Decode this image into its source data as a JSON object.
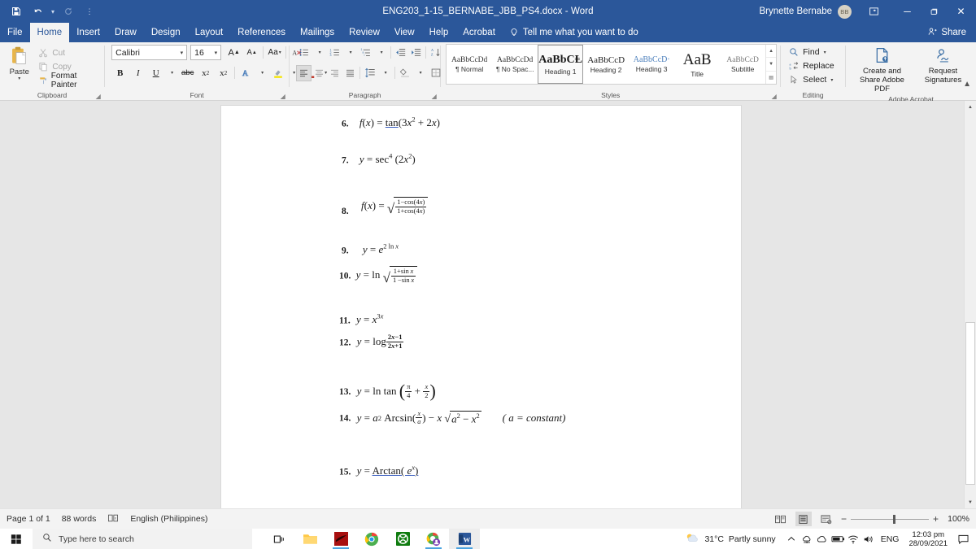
{
  "titlebar": {
    "document_title": "ENG203_1-15_BERNABE_JBB_PS4.docx  -  Word",
    "account_name": "Brynette Bernabe",
    "avatar_initials": "BB",
    "quick_access": [
      "save-icon",
      "undo-icon",
      "redo-icon",
      "customize-icon"
    ],
    "window_buttons": {
      "minimize": "─",
      "restore": "❐",
      "close": "✕"
    }
  },
  "tabs": [
    {
      "label": "File",
      "active": false
    },
    {
      "label": "Home",
      "active": true
    },
    {
      "label": "Insert",
      "active": false
    },
    {
      "label": "Draw",
      "active": false
    },
    {
      "label": "Design",
      "active": false
    },
    {
      "label": "Layout",
      "active": false
    },
    {
      "label": "References",
      "active": false
    },
    {
      "label": "Mailings",
      "active": false
    },
    {
      "label": "Review",
      "active": false
    },
    {
      "label": "View",
      "active": false
    },
    {
      "label": "Help",
      "active": false
    },
    {
      "label": "Acrobat",
      "active": false
    }
  ],
  "tell_me": "Tell me what you want to do",
  "share_label": "Share",
  "ribbon": {
    "clipboard": {
      "group_label": "Clipboard",
      "paste_label": "Paste",
      "items": [
        {
          "label": "Cut",
          "icon": "scissors-icon",
          "enabled": false
        },
        {
          "label": "Copy",
          "icon": "copy-icon",
          "enabled": false
        },
        {
          "label": "Format Painter",
          "icon": "format-painter-icon",
          "enabled": true
        }
      ]
    },
    "font": {
      "group_label": "Font",
      "font_family": "Calibri",
      "font_size": "16",
      "buttons_row1": [
        "grow-font-icon",
        "shrink-font-icon",
        "change-case-icon",
        "clear-formatting-icon"
      ],
      "buttons_row2": [
        "bold-icon",
        "italic-icon",
        "underline-icon",
        "strikethrough-icon",
        "subscript-icon",
        "superscript-icon",
        "text-effects-icon",
        "text-highlight-icon",
        "font-color-icon"
      ]
    },
    "paragraph": {
      "group_label": "Paragraph",
      "row1": [
        "bullets-icon",
        "numbering-icon",
        "multilevel-list-icon",
        "decrease-indent-icon",
        "increase-indent-icon",
        "sort-icon",
        "show-formatting-marks-icon"
      ],
      "row2": [
        "align-left-icon",
        "align-center-icon",
        "align-right-icon",
        "justify-icon",
        "line-spacing-icon",
        "shading-icon",
        "borders-icon"
      ]
    },
    "styles": {
      "group_label": "Styles",
      "items": [
        {
          "preview": "AaBbCcDd",
          "name": "¶ Normal",
          "selected": false
        },
        {
          "preview": "AaBbCcDd",
          "name": "¶ No Spac...",
          "selected": false
        },
        {
          "preview": "AaBbCⱠ",
          "name": "Heading 1",
          "selected": true
        },
        {
          "preview": "AaBbCcD",
          "name": "Heading 2",
          "selected": false
        },
        {
          "preview": "AaBbCcD‧",
          "name": "Heading 3",
          "selected": false
        },
        {
          "preview": "AaB",
          "name": "Title",
          "selected": false
        },
        {
          "preview": "AaBbCcD",
          "name": "Subtitle",
          "selected": false
        }
      ]
    },
    "editing": {
      "group_label": "Editing",
      "items": [
        {
          "label": "Find",
          "icon": "search-icon",
          "has_caret": true
        },
        {
          "label": "Replace",
          "icon": "replace-icon",
          "has_caret": false
        },
        {
          "label": "Select",
          "icon": "select-icon",
          "has_caret": true
        }
      ]
    },
    "adobe_acrobat": {
      "group_label": "Adobe Acrobat",
      "items": [
        {
          "label": "Create and Share Adobe PDF",
          "icon": "create-pdf-icon"
        },
        {
          "label": "Request Signatures",
          "icon": "request-signature-icon"
        }
      ]
    }
  },
  "document": {
    "problems": [
      {
        "number": "6.",
        "text": "f(x) = tan(3x² + 2x)"
      },
      {
        "number": "7.",
        "text": "y = sec⁴ (2x²)"
      },
      {
        "number": "8.",
        "text": "f(x) = √((1−cos(4x))/(1+cos(4x)))"
      },
      {
        "number": "9.",
        "text": "y = e^(2 ln x)"
      },
      {
        "number": "10.",
        "text": "y = ln √((1+sin x)/(1−sin x))"
      },
      {
        "number": "11.",
        "text": "y = x^(3x)"
      },
      {
        "number": "12.",
        "text": "y = log (2x−1)/(2x+1)"
      },
      {
        "number": "13.",
        "text": "y = ln tan (π/4 + x/2)"
      },
      {
        "number": "14.",
        "text": "y = a² Arcsin(x/a) − x √(a² − x²)    ( a = constant)"
      },
      {
        "number": "15.",
        "text": "y = Arctan( eˣ)"
      }
    ],
    "eq14_note": "( a =  constant)"
  },
  "statusbar": {
    "page": "Page 1 of 1",
    "words": "88 words",
    "proofing_icon": "proofing-errors-icon",
    "language": "English (Philippines)",
    "views": [
      "read-mode-icon",
      "print-layout-icon",
      "web-layout-icon"
    ],
    "zoom_out": "−",
    "zoom_in": "+",
    "zoom_value": "100%"
  },
  "taskbar": {
    "start_icon": "windows-start-icon",
    "search_placeholder": "Type here to search",
    "search_icon": "search-icon",
    "icons": [
      {
        "name": "task-view-icon",
        "active": false
      },
      {
        "name": "file-explorer-icon",
        "active": false
      },
      {
        "name": "red-app-icon",
        "active": false
      },
      {
        "name": "chrome-icon",
        "active": false
      },
      {
        "name": "xbox-icon",
        "active": false
      },
      {
        "name": "chrome-profile-icon",
        "active": false
      },
      {
        "name": "word-icon",
        "active": true
      }
    ],
    "weather_temp": "31°C",
    "weather_desc": "Partly sunny",
    "tray_icons": [
      "chevron-up-icon",
      "onedrive-sync-icon",
      "onedrive-cloud-icon",
      "battery-icon",
      "wifi-icon",
      "volume-icon"
    ],
    "language_indicator": "ENG",
    "time": "12:03 pm",
    "date": "28/09/2021",
    "notification_icon": "notifications-icon"
  },
  "colors": {
    "word_blue": "#2b579a",
    "ribbon_bg": "#f3f3f3",
    "doc_bg": "#e6e6e6",
    "accent_link": "#3b5fc0"
  }
}
